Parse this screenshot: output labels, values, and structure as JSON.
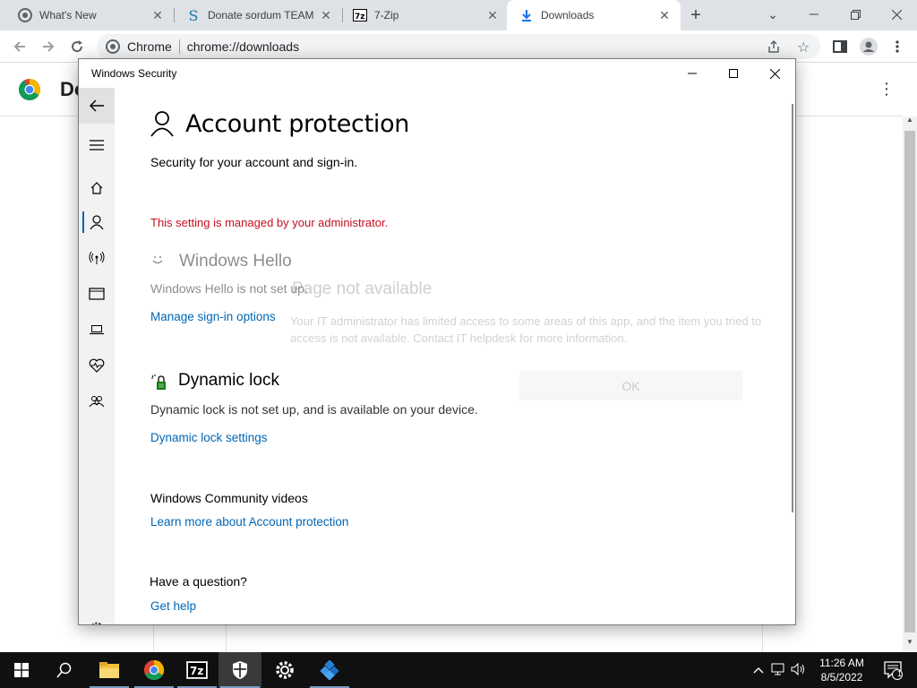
{
  "browser": {
    "tabs": [
      {
        "title": "What's New",
        "icon": "chrome-icon"
      },
      {
        "title": "Donate sordum TEAM",
        "icon": "sordum-icon"
      },
      {
        "title": "7-Zip",
        "icon": "7zip-icon"
      },
      {
        "title": "Downloads",
        "icon": "download-icon",
        "active": true
      }
    ],
    "omnibox": {
      "site_label": "Chrome",
      "url": "chrome://downloads"
    }
  },
  "downloads_page": {
    "title": "Do"
  },
  "security_window": {
    "title": "Windows Security",
    "page_title": "Account protection",
    "subtitle": "Security for your account and sign-in.",
    "admin_message": "This setting is managed by your administrator.",
    "windows_hello": {
      "title": "Windows Hello",
      "status": "Windows Hello is not set up.",
      "link": "Manage sign-in options"
    },
    "dynamic_lock": {
      "title": "Dynamic lock",
      "status": "Dynamic lock is not set up, and is available on your device.",
      "link": "Dynamic lock settings"
    },
    "community": {
      "title": "Windows Community videos",
      "link": "Learn more about Account protection"
    },
    "question": {
      "title": "Have a question?",
      "link": "Get help"
    },
    "overlay": {
      "title": "Page not available",
      "body": "Your IT administrator has limited access to some areas of this app, and the item you tried to access is not available. Contact IT helpdesk for more information.",
      "ok": "OK"
    },
    "accent_color": "#0066b4",
    "warning_color": "#c50f1f"
  },
  "taskbar": {
    "clock_time": "11:26 AM",
    "clock_date": "8/5/2022",
    "notification_count": "1"
  }
}
